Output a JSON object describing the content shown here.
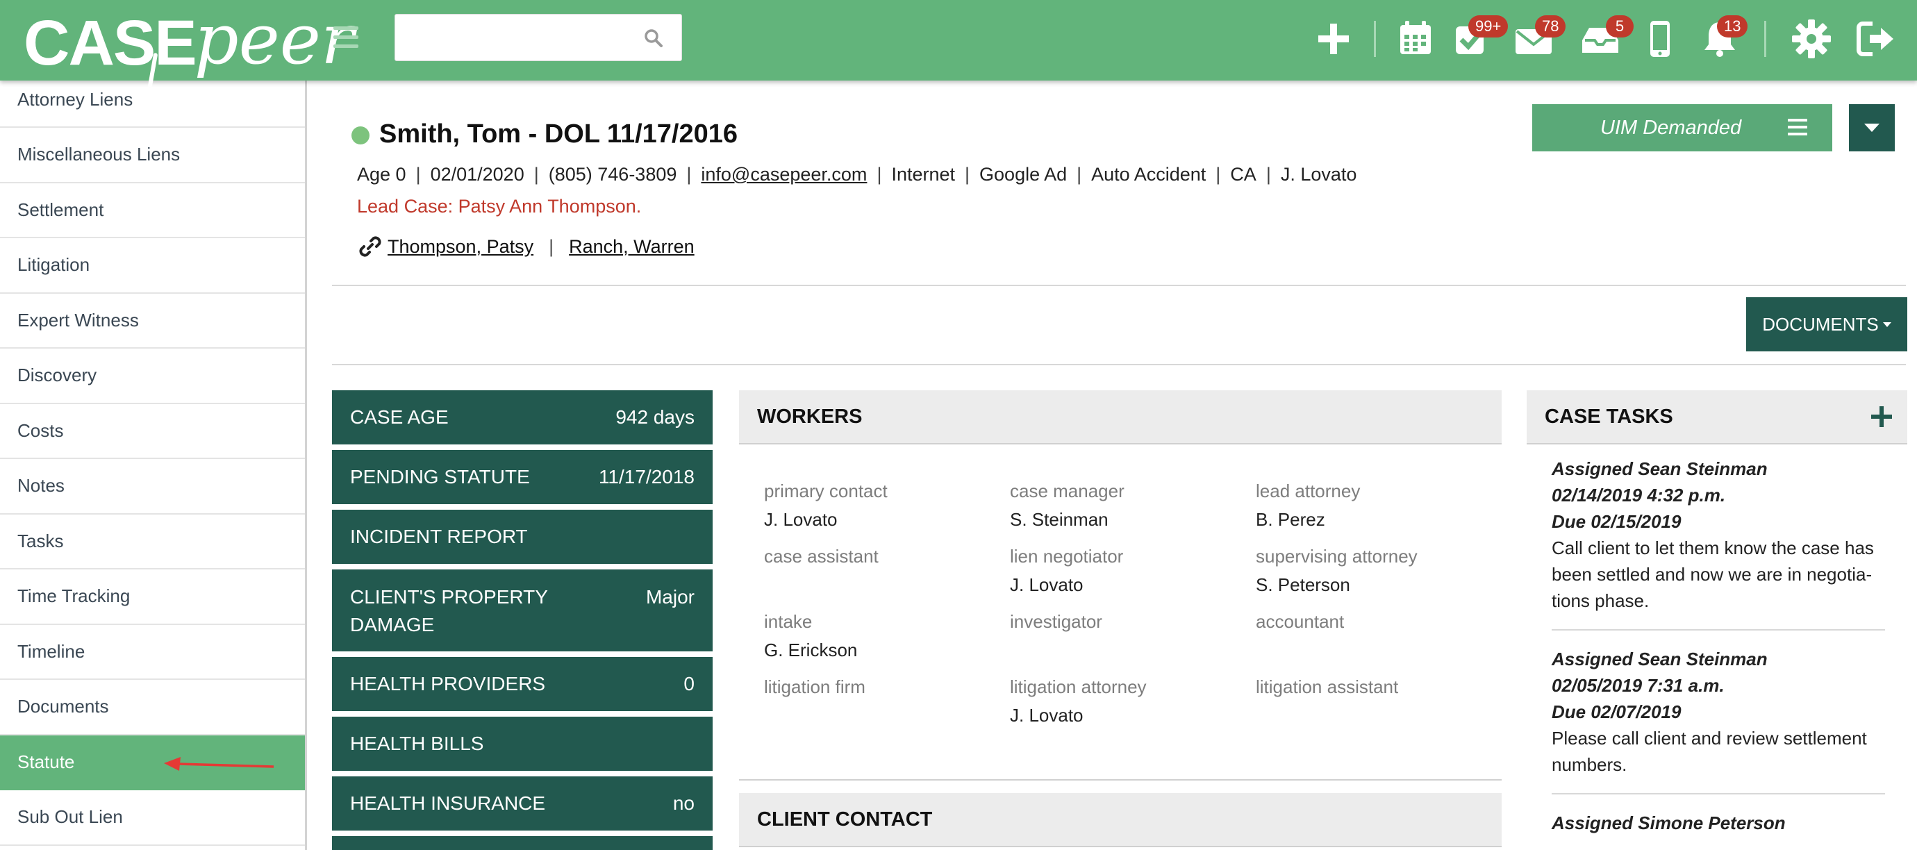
{
  "colors": {
    "brand_green": "#62b47b",
    "dark_teal": "#22594f",
    "badge_red": "#c0392b",
    "lead_red": "#c0392b"
  },
  "topbar": {
    "logo_case": "CASE",
    "logo_peer": "peer",
    "search": {
      "value": "",
      "placeholder": ""
    },
    "icons": [
      "plus-icon",
      "calendar-icon",
      "tasks-check-icon",
      "mail-icon",
      "inbox-icon",
      "phone-icon",
      "bell-icon",
      "gear-icon",
      "logout-icon"
    ],
    "badges": {
      "tasks": "99+",
      "mail": "78",
      "inbox": "5",
      "notifications": "13"
    }
  },
  "sidebar": {
    "items": [
      {
        "label": "Attorney Liens"
      },
      {
        "label": "Miscellaneous Liens"
      },
      {
        "label": "Settlement"
      },
      {
        "label": "Litigation"
      },
      {
        "label": "Expert Witness"
      },
      {
        "label": "Discovery"
      },
      {
        "label": "Costs"
      },
      {
        "label": "Notes"
      },
      {
        "label": "Tasks"
      },
      {
        "label": "Time Tracking"
      },
      {
        "label": "Timeline"
      },
      {
        "label": "Documents"
      },
      {
        "label": "Statute"
      },
      {
        "label": "Sub Out Lien"
      }
    ],
    "active_index": 12
  },
  "case": {
    "title": "Smith, Tom - DOL 11/17/2016",
    "age": "Age 0",
    "date": "02/01/2020",
    "phone": "(805) 746-3809",
    "email": "info@casepeer.com",
    "source": "Internet",
    "source_detail": "Google Ad",
    "case_type": "Auto Accident",
    "state": "CA",
    "owner": "J. Lovato",
    "lead_case": "Lead Case: Patsy Ann Thompson.",
    "related": [
      "Thompson, Patsy",
      "Ranch, Warren"
    ],
    "stage": "UIM Demanded"
  },
  "documents_button": "DOCUMENTS",
  "stats": [
    {
      "label": "CASE AGE",
      "value": "942 days"
    },
    {
      "label": "PENDING STATUTE",
      "value": "11/17/2018"
    },
    {
      "label": "INCIDENT REPORT",
      "value": ""
    },
    {
      "label": "CLIENT'S PROPERTY DAMAGE",
      "value": "Major"
    },
    {
      "label": "HEALTH PROVIDERS",
      "value": "0"
    },
    {
      "label": "HEALTH BILLS",
      "value": ""
    },
    {
      "label": "HEALTH INSURANCE",
      "value": "no"
    }
  ],
  "workers": {
    "title": "WORKERS",
    "cells": [
      {
        "role": "primary contact",
        "name": "J. Lovato"
      },
      {
        "role": "case manager",
        "name": "S. Steinman"
      },
      {
        "role": "lead attorney",
        "name": "B. Perez"
      },
      {
        "role": "case assistant",
        "name": ""
      },
      {
        "role": "lien negotiator",
        "name": "J. Lovato"
      },
      {
        "role": "supervising attorney",
        "name": "S. Peterson"
      },
      {
        "role": "intake",
        "name": "G. Erickson"
      },
      {
        "role": "investigator",
        "name": ""
      },
      {
        "role": "accountant",
        "name": ""
      },
      {
        "role": "litigation firm",
        "name": ""
      },
      {
        "role": "litigation attorney",
        "name": "J. Lovato"
      },
      {
        "role": "litigation assistant",
        "name": ""
      }
    ]
  },
  "client_contact": {
    "title": "CLIENT CONTACT"
  },
  "case_tasks": {
    "title": "CASE TASKS",
    "items": [
      {
        "assigned": "Assigned Sean Steinman",
        "date": "02/14/2019 4:32 p.m.",
        "due": "Due 02/15/2019",
        "desc": "Call client to let them know the case has been settled and now we are in negotia­tions phase."
      },
      {
        "assigned": "Assigned Sean Steinman",
        "date": "02/05/2019 7:31 a.m.",
        "due": "Due 02/07/2019",
        "desc": "Please call client and review settlement numbers."
      },
      {
        "assigned": "Assigned Simone Peterson",
        "date": "",
        "due": "",
        "desc": ""
      }
    ]
  }
}
